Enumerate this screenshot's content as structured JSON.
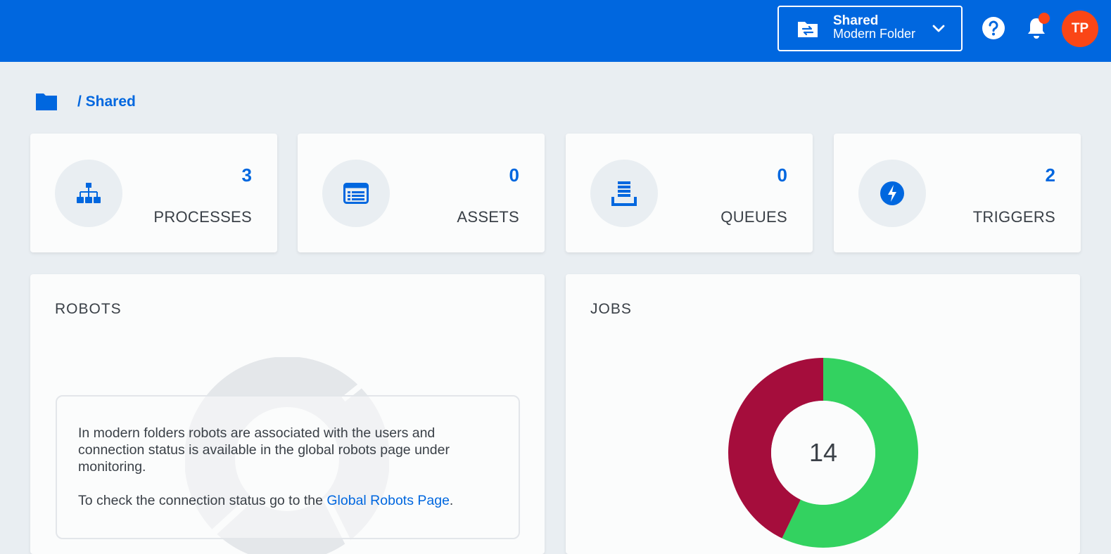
{
  "header": {
    "folder_switcher": {
      "name": "Shared",
      "type": "Modern Folder"
    },
    "avatar_initials": "TP",
    "notification_badge": true
  },
  "breadcrumb": {
    "text": "/ Shared"
  },
  "stats": [
    {
      "label": "PROCESSES",
      "count": "3",
      "icon": "sitemap-icon"
    },
    {
      "label": "ASSETS",
      "count": "0",
      "icon": "list-card-icon"
    },
    {
      "label": "QUEUES",
      "count": "0",
      "icon": "queue-stack-icon"
    },
    {
      "label": "TRIGGERS",
      "count": "2",
      "icon": "lightning-icon"
    }
  ],
  "robots_panel": {
    "title": "ROBOTS",
    "note_line1": "In modern folders robots are associated with the users and connection status is available in the global robots page under monitoring.",
    "note_line2_prefix": "To check the connection status go to the ",
    "note_link": "Global Robots Page",
    "note_line2_suffix": "."
  },
  "jobs_panel": {
    "title": "JOBS",
    "total": "14"
  },
  "chart_data": {
    "type": "pie",
    "donut": true,
    "center_label": "14",
    "slices": [
      {
        "value": 8,
        "color": "#33d260"
      },
      {
        "value": 6,
        "color": "#a50d3c"
      }
    ]
  },
  "colors": {
    "brand": "#0067df",
    "accent": "#fa4616",
    "background": "#e9eef2",
    "card": "#fbfcfc"
  }
}
